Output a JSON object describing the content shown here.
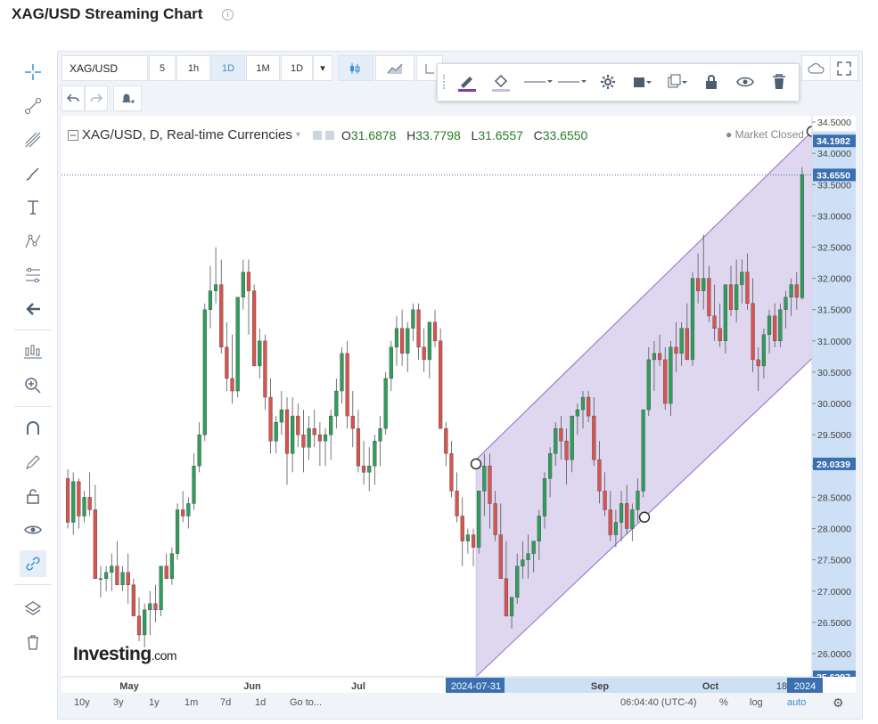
{
  "page": {
    "title": "XAG/USD Streaming Chart"
  },
  "toolbar": {
    "symbol": "XAG/USD",
    "resolutions": [
      "5",
      "1h",
      "1D",
      "1M",
      "1D"
    ],
    "active_resolution": "1D"
  },
  "header": {
    "series_title": "XAG/USD, D, Real-time Currencies",
    "open_label": "O",
    "open": "31.6878",
    "high_label": "H",
    "high": "33.7798",
    "low_label": "L",
    "low": "31.6557",
    "close_label": "C",
    "close": "33.6550",
    "market_status": "Market Closed"
  },
  "logo": {
    "text": "Investing",
    "suffix": ".com"
  },
  "bottom_bar": {
    "ranges": [
      "10y",
      "3y",
      "1y",
      "1m",
      "7d",
      "1d"
    ],
    "goto": "Go to...",
    "clock": "06:04:40 (UTC-4)",
    "percent": "%",
    "log": "log",
    "auto": "auto"
  },
  "chart_data": {
    "type": "candlestick",
    "ylim": [
      25.6297,
      34.6
    ],
    "y_ticks": [
      "34.5000",
      "34.0000",
      "33.5000",
      "33.0000",
      "32.5000",
      "32.0000",
      "31.5000",
      "31.0000",
      "30.5000",
      "30.0000",
      "29.5000",
      "29.0000",
      "28.5000",
      "28.0000",
      "27.5000",
      "27.0000",
      "26.5000",
      "26.0000"
    ],
    "x_labels": [
      "May",
      "Jun",
      "Jul",
      "Sep",
      "Oct"
    ],
    "x_highlight_labels": [
      "2024-07-31",
      "18",
      "2024"
    ],
    "price_labels": {
      "channel_top": "34.1982",
      "last_price": "33.6550",
      "channel_anchor": "29.0339",
      "axis_bottom": "25.6297"
    },
    "last_price": 33.655,
    "colors": {
      "up": "#2e9e5b",
      "down": "#d9534f",
      "channel_fill": "#d8d0ec",
      "channel_line": "#9b7fcf"
    },
    "candles": [
      [
        28.8,
        28.95,
        28.0,
        28.1
      ],
      [
        28.1,
        28.9,
        27.9,
        28.75
      ],
      [
        28.75,
        28.8,
        28.0,
        28.2
      ],
      [
        28.2,
        28.6,
        28.1,
        28.5
      ],
      [
        28.5,
        28.9,
        28.2,
        28.3
      ],
      [
        28.3,
        28.7,
        27.3,
        27.2
      ],
      [
        27.2,
        27.4,
        26.9,
        27.2
      ],
      [
        27.2,
        27.4,
        27.0,
        27.3
      ],
      [
        27.3,
        27.6,
        27.0,
        27.4
      ],
      [
        27.4,
        27.8,
        27.1,
        27.1
      ],
      [
        27.1,
        27.4,
        27.0,
        27.3
      ],
      [
        27.3,
        27.6,
        26.8,
        27.1
      ],
      [
        27.1,
        27.2,
        26.7,
        26.6
      ],
      [
        26.6,
        26.9,
        26.2,
        26.3
      ],
      [
        26.3,
        26.8,
        26.1,
        26.7
      ],
      [
        26.7,
        27.0,
        26.3,
        26.8
      ],
      [
        26.8,
        27.1,
        26.5,
        26.7
      ],
      [
        26.7,
        27.4,
        26.6,
        27.4
      ],
      [
        27.4,
        27.6,
        27.2,
        27.2
      ],
      [
        27.2,
        27.7,
        27.1,
        27.6
      ],
      [
        27.6,
        28.4,
        27.5,
        28.3
      ],
      [
        28.3,
        28.6,
        28.1,
        28.2
      ],
      [
        28.2,
        28.5,
        28.0,
        28.4
      ],
      [
        28.4,
        29.2,
        28.3,
        29.0
      ],
      [
        29.0,
        29.7,
        28.9,
        29.5
      ],
      [
        29.5,
        31.6,
        29.4,
        31.5
      ],
      [
        31.5,
        32.2,
        31.2,
        31.8
      ],
      [
        31.8,
        32.5,
        31.6,
        31.9
      ],
      [
        31.9,
        32.3,
        30.8,
        30.9
      ],
      [
        30.9,
        31.3,
        30.2,
        30.4
      ],
      [
        30.4,
        31.1,
        30.0,
        30.2
      ],
      [
        30.2,
        31.7,
        30.1,
        31.7
      ],
      [
        31.7,
        32.3,
        31.5,
        32.1
      ],
      [
        32.1,
        32.3,
        31.1,
        31.8
      ],
      [
        31.8,
        31.9,
        30.6,
        30.6
      ],
      [
        30.6,
        31.2,
        30.4,
        31.0
      ],
      [
        31.0,
        31.1,
        29.9,
        30.1
      ],
      [
        30.1,
        30.4,
        29.2,
        29.4
      ],
      [
        29.4,
        29.8,
        29.2,
        29.7
      ],
      [
        29.7,
        30.2,
        29.5,
        29.9
      ],
      [
        29.9,
        30.1,
        28.7,
        29.2
      ],
      [
        29.2,
        30.1,
        28.9,
        29.8
      ],
      [
        29.8,
        30.0,
        29.3,
        29.5
      ],
      [
        29.5,
        29.9,
        28.9,
        29.3
      ],
      [
        29.3,
        29.8,
        29.1,
        29.6
      ],
      [
        29.6,
        29.9,
        29.3,
        29.5
      ],
      [
        29.5,
        29.7,
        29.0,
        29.4
      ],
      [
        29.4,
        29.6,
        29.0,
        29.5
      ],
      [
        29.5,
        29.9,
        29.1,
        29.8
      ],
      [
        29.8,
        30.4,
        29.6,
        30.2
      ],
      [
        30.2,
        30.9,
        30.0,
        30.8
      ],
      [
        30.8,
        31.0,
        29.6,
        29.8
      ],
      [
        29.8,
        30.2,
        29.3,
        29.6
      ],
      [
        29.6,
        29.9,
        28.9,
        29.0
      ],
      [
        29.0,
        29.4,
        28.7,
        28.9
      ],
      [
        28.9,
        29.3,
        28.6,
        29.0
      ],
      [
        29.0,
        29.5,
        28.7,
        29.4
      ],
      [
        29.4,
        29.8,
        29.0,
        29.6
      ],
      [
        29.6,
        30.5,
        29.5,
        30.4
      ],
      [
        30.4,
        31.0,
        30.2,
        30.9
      ],
      [
        30.9,
        31.4,
        30.6,
        31.2
      ],
      [
        31.2,
        31.5,
        30.6,
        30.8
      ],
      [
        30.8,
        31.3,
        30.5,
        31.2
      ],
      [
        31.2,
        31.6,
        31.0,
        31.5
      ],
      [
        31.5,
        31.6,
        30.7,
        30.9
      ],
      [
        30.9,
        31.2,
        30.5,
        30.7
      ],
      [
        30.7,
        31.3,
        30.4,
        31.3
      ],
      [
        31.3,
        31.5,
        30.9,
        31.0
      ],
      [
        31.0,
        31.2,
        29.9,
        29.6
      ],
      [
        29.6,
        29.7,
        29.0,
        29.2
      ],
      [
        29.2,
        29.4,
        28.5,
        28.6
      ],
      [
        28.6,
        28.9,
        28.1,
        28.2
      ],
      [
        28.2,
        28.5,
        27.4,
        27.8
      ],
      [
        27.8,
        28.0,
        27.6,
        27.9
      ],
      [
        27.9,
        28.0,
        27.4,
        27.7
      ],
      [
        27.7,
        28.6,
        27.6,
        28.6
      ],
      [
        28.6,
        29.2,
        28.2,
        29.0
      ],
      [
        29.0,
        29.2,
        28.0,
        28.4
      ],
      [
        28.4,
        28.6,
        27.8,
        27.9
      ],
      [
        27.9,
        28.4,
        27.4,
        27.2
      ],
      [
        27.2,
        27.8,
        26.6,
        26.6
      ],
      [
        26.6,
        26.9,
        26.4,
        26.9
      ],
      [
        26.9,
        27.6,
        26.8,
        27.4
      ],
      [
        27.4,
        27.8,
        27.2,
        27.5
      ],
      [
        27.5,
        27.9,
        27.2,
        27.6
      ],
      [
        27.6,
        27.8,
        27.3,
        27.8
      ],
      [
        27.8,
        28.3,
        27.5,
        28.2
      ],
      [
        28.2,
        28.9,
        28.0,
        28.8
      ],
      [
        28.8,
        29.3,
        28.5,
        29.2
      ],
      [
        29.2,
        29.7,
        29.0,
        29.6
      ],
      [
        29.6,
        29.8,
        29.1,
        29.4
      ],
      [
        29.4,
        29.6,
        28.7,
        29.1
      ],
      [
        29.1,
        29.8,
        28.9,
        29.8
      ],
      [
        29.8,
        30.0,
        29.5,
        29.9
      ],
      [
        29.9,
        30.2,
        29.6,
        30.1
      ],
      [
        30.1,
        30.2,
        29.7,
        29.8
      ],
      [
        29.8,
        30.1,
        29.0,
        29.1
      ],
      [
        29.1,
        29.4,
        28.4,
        28.6
      ],
      [
        28.6,
        28.9,
        28.2,
        28.3
      ],
      [
        28.3,
        28.6,
        27.8,
        27.9
      ],
      [
        27.9,
        28.3,
        27.7,
        28.1
      ],
      [
        28.1,
        28.6,
        27.8,
        28.4
      ],
      [
        28.4,
        28.7,
        27.9,
        28.0
      ],
      [
        28.0,
        28.4,
        27.8,
        28.3
      ],
      [
        28.3,
        28.8,
        28.1,
        28.6
      ],
      [
        28.6,
        29.9,
        28.5,
        29.9
      ],
      [
        29.9,
        30.9,
        29.8,
        30.7
      ],
      [
        30.7,
        31.0,
        30.2,
        30.8
      ],
      [
        30.8,
        31.1,
        30.6,
        30.7
      ],
      [
        30.7,
        30.9,
        29.9,
        30.0
      ],
      [
        30.0,
        31.0,
        29.8,
        30.9
      ],
      [
        30.9,
        31.3,
        30.5,
        30.8
      ],
      [
        30.8,
        31.3,
        30.6,
        31.2
      ],
      [
        31.2,
        31.6,
        30.7,
        30.7
      ],
      [
        30.7,
        32.1,
        30.6,
        32.0
      ],
      [
        32.0,
        32.4,
        31.6,
        31.8
      ],
      [
        31.8,
        32.7,
        31.5,
        32.0
      ],
      [
        32.0,
        32.2,
        31.3,
        31.4
      ],
      [
        31.4,
        31.9,
        31.0,
        31.2
      ],
      [
        31.2,
        31.6,
        30.9,
        31.0
      ],
      [
        31.0,
        31.9,
        30.8,
        31.9
      ],
      [
        31.9,
        32.2,
        31.4,
        31.5
      ],
      [
        31.5,
        32.3,
        31.3,
        31.9
      ],
      [
        31.9,
        32.3,
        31.6,
        32.1
      ],
      [
        32.1,
        32.4,
        31.5,
        31.6
      ],
      [
        31.6,
        32.0,
        30.5,
        30.7
      ],
      [
        30.7,
        30.9,
        30.2,
        30.6
      ],
      [
        30.6,
        31.2,
        30.4,
        31.1
      ],
      [
        31.1,
        31.5,
        30.8,
        31.4
      ],
      [
        31.4,
        31.6,
        30.9,
        31.0
      ],
      [
        31.0,
        31.6,
        30.9,
        31.5
      ],
      [
        31.5,
        31.8,
        31.2,
        31.7
      ],
      [
        31.7,
        32.0,
        31.4,
        31.9
      ],
      [
        31.9,
        32.1,
        31.5,
        31.7
      ],
      [
        31.69,
        33.78,
        31.66,
        33.66
      ]
    ]
  }
}
